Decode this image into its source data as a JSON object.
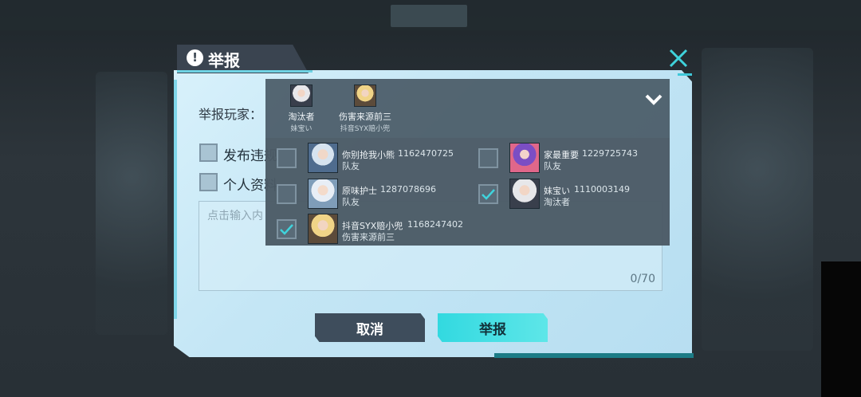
{
  "dialog": {
    "title": "举报",
    "title_icon": "!",
    "report_player_label": "举报玩家：",
    "selected_players": [
      {
        "name": "淘汰者",
        "sub": "妹宝い"
      },
      {
        "name": "伤害来源前三",
        "sub": "抖音SYX赔小兜"
      }
    ],
    "options": [
      {
        "label": "发布违规"
      },
      {
        "label": "个人资料"
      }
    ],
    "textarea": {
      "placeholder": "点击输入内",
      "counter": "0/70"
    },
    "buttons": {
      "cancel": "取消",
      "report": "举报"
    }
  },
  "player_list": [
    {
      "name": "你别抢我小熊",
      "id": "1162470725",
      "role": "队友",
      "checked": false
    },
    {
      "name": "家最重要",
      "id": "1229725743",
      "role": "队友",
      "checked": false
    },
    {
      "name": "原味护士",
      "id": "1287078696",
      "role": "队友",
      "checked": false
    },
    {
      "name": "妹宝い",
      "id": "1110003149",
      "role": "淘汰者",
      "checked": true
    },
    {
      "name": "抖音SYX赔小兜",
      "id": "1168247402",
      "role": "伤害来源前三",
      "checked": true
    }
  ],
  "colors": {
    "accent": "#3fd3dc",
    "dialog_bg": "#c4e6f5",
    "panel_dark": "#4b5965",
    "button_cancel": "#3e4d5c"
  },
  "icons": {
    "title": "exclamation-icon",
    "close": "close-x-icon",
    "dropdown": "chevron-down-icon",
    "check": "checkmark-icon"
  }
}
